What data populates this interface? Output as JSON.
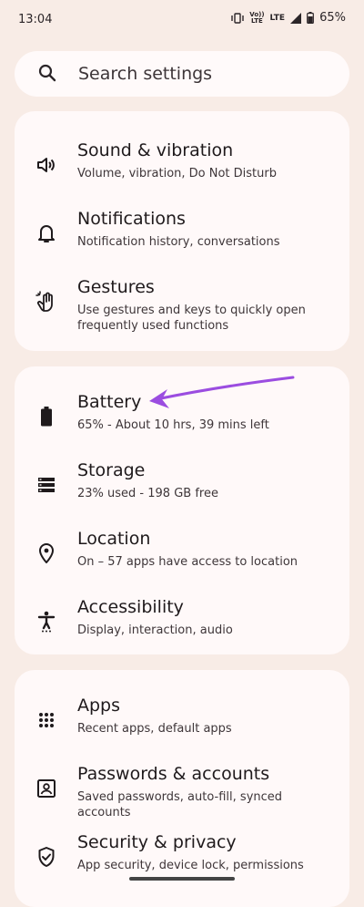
{
  "status_bar": {
    "time": "13:04",
    "volte_top": "Vo))",
    "volte_bottom": "LTE",
    "lte": "LTE",
    "battery_percent": "65%"
  },
  "search": {
    "label": "Search settings"
  },
  "groups": [
    {
      "items": [
        {
          "title": "Sound & vibration",
          "subtitle": "Volume, vibration, Do Not Disturb",
          "icon": "speaker-icon"
        },
        {
          "title": "Notifications",
          "subtitle": "Notification history, conversations",
          "icon": "bell-icon"
        },
        {
          "title": "Gestures",
          "subtitle": "Use gestures and keys to quickly open frequently used functions",
          "icon": "gesture-hand-icon"
        }
      ]
    },
    {
      "items": [
        {
          "title": "Battery",
          "subtitle": "65% - About 10 hrs, 39 mins left",
          "icon": "battery-icon"
        },
        {
          "title": "Storage",
          "subtitle": "23% used - 198 GB free",
          "icon": "storage-icon"
        },
        {
          "title": "Location",
          "subtitle": "On – 57 apps have access to location",
          "icon": "location-pin-icon"
        },
        {
          "title": "Accessibility",
          "subtitle": "Display, interaction, audio",
          "icon": "accessibility-icon"
        }
      ]
    },
    {
      "items": [
        {
          "title": "Apps",
          "subtitle": "Recent apps, default apps",
          "icon": "apps-grid-icon"
        },
        {
          "title": "Passwords & accounts",
          "subtitle": "Saved passwords, auto-fill, synced accounts",
          "icon": "account-box-icon"
        },
        {
          "title": "Security & privacy",
          "subtitle": "App security, device lock, permissions",
          "icon": "shield-check-icon"
        }
      ]
    }
  ],
  "colors": {
    "background": "#f8ece6",
    "card": "#fff9f9",
    "annotation_arrow": "#9b4de0"
  }
}
